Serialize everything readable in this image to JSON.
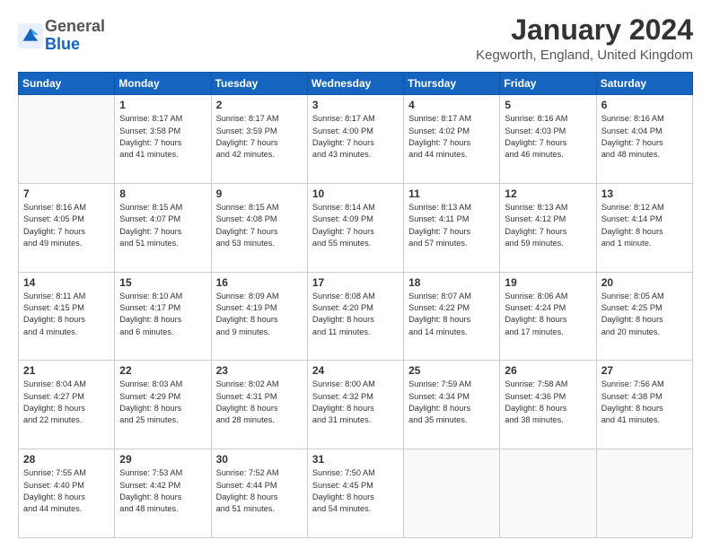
{
  "header": {
    "logo_general": "General",
    "logo_blue": "Blue",
    "month_title": "January 2024",
    "location": "Kegworth, England, United Kingdom"
  },
  "weekdays": [
    "Sunday",
    "Monday",
    "Tuesday",
    "Wednesday",
    "Thursday",
    "Friday",
    "Saturday"
  ],
  "weeks": [
    [
      {
        "day": "",
        "info": ""
      },
      {
        "day": "1",
        "info": "Sunrise: 8:17 AM\nSunset: 3:58 PM\nDaylight: 7 hours\nand 41 minutes."
      },
      {
        "day": "2",
        "info": "Sunrise: 8:17 AM\nSunset: 3:59 PM\nDaylight: 7 hours\nand 42 minutes."
      },
      {
        "day": "3",
        "info": "Sunrise: 8:17 AM\nSunset: 4:00 PM\nDaylight: 7 hours\nand 43 minutes."
      },
      {
        "day": "4",
        "info": "Sunrise: 8:17 AM\nSunset: 4:02 PM\nDaylight: 7 hours\nand 44 minutes."
      },
      {
        "day": "5",
        "info": "Sunrise: 8:16 AM\nSunset: 4:03 PM\nDaylight: 7 hours\nand 46 minutes."
      },
      {
        "day": "6",
        "info": "Sunrise: 8:16 AM\nSunset: 4:04 PM\nDaylight: 7 hours\nand 48 minutes."
      }
    ],
    [
      {
        "day": "7",
        "info": "Sunrise: 8:16 AM\nSunset: 4:05 PM\nDaylight: 7 hours\nand 49 minutes."
      },
      {
        "day": "8",
        "info": "Sunrise: 8:15 AM\nSunset: 4:07 PM\nDaylight: 7 hours\nand 51 minutes."
      },
      {
        "day": "9",
        "info": "Sunrise: 8:15 AM\nSunset: 4:08 PM\nDaylight: 7 hours\nand 53 minutes."
      },
      {
        "day": "10",
        "info": "Sunrise: 8:14 AM\nSunset: 4:09 PM\nDaylight: 7 hours\nand 55 minutes."
      },
      {
        "day": "11",
        "info": "Sunrise: 8:13 AM\nSunset: 4:11 PM\nDaylight: 7 hours\nand 57 minutes."
      },
      {
        "day": "12",
        "info": "Sunrise: 8:13 AM\nSunset: 4:12 PM\nDaylight: 7 hours\nand 59 minutes."
      },
      {
        "day": "13",
        "info": "Sunrise: 8:12 AM\nSunset: 4:14 PM\nDaylight: 8 hours\nand 1 minute."
      }
    ],
    [
      {
        "day": "14",
        "info": "Sunrise: 8:11 AM\nSunset: 4:15 PM\nDaylight: 8 hours\nand 4 minutes."
      },
      {
        "day": "15",
        "info": "Sunrise: 8:10 AM\nSunset: 4:17 PM\nDaylight: 8 hours\nand 6 minutes."
      },
      {
        "day": "16",
        "info": "Sunrise: 8:09 AM\nSunset: 4:19 PM\nDaylight: 8 hours\nand 9 minutes."
      },
      {
        "day": "17",
        "info": "Sunrise: 8:08 AM\nSunset: 4:20 PM\nDaylight: 8 hours\nand 11 minutes."
      },
      {
        "day": "18",
        "info": "Sunrise: 8:07 AM\nSunset: 4:22 PM\nDaylight: 8 hours\nand 14 minutes."
      },
      {
        "day": "19",
        "info": "Sunrise: 8:06 AM\nSunset: 4:24 PM\nDaylight: 8 hours\nand 17 minutes."
      },
      {
        "day": "20",
        "info": "Sunrise: 8:05 AM\nSunset: 4:25 PM\nDaylight: 8 hours\nand 20 minutes."
      }
    ],
    [
      {
        "day": "21",
        "info": "Sunrise: 8:04 AM\nSunset: 4:27 PM\nDaylight: 8 hours\nand 22 minutes."
      },
      {
        "day": "22",
        "info": "Sunrise: 8:03 AM\nSunset: 4:29 PM\nDaylight: 8 hours\nand 25 minutes."
      },
      {
        "day": "23",
        "info": "Sunrise: 8:02 AM\nSunset: 4:31 PM\nDaylight: 8 hours\nand 28 minutes."
      },
      {
        "day": "24",
        "info": "Sunrise: 8:00 AM\nSunset: 4:32 PM\nDaylight: 8 hours\nand 31 minutes."
      },
      {
        "day": "25",
        "info": "Sunrise: 7:59 AM\nSunset: 4:34 PM\nDaylight: 8 hours\nand 35 minutes."
      },
      {
        "day": "26",
        "info": "Sunrise: 7:58 AM\nSunset: 4:36 PM\nDaylight: 8 hours\nand 38 minutes."
      },
      {
        "day": "27",
        "info": "Sunrise: 7:56 AM\nSunset: 4:38 PM\nDaylight: 8 hours\nand 41 minutes."
      }
    ],
    [
      {
        "day": "28",
        "info": "Sunrise: 7:55 AM\nSunset: 4:40 PM\nDaylight: 8 hours\nand 44 minutes."
      },
      {
        "day": "29",
        "info": "Sunrise: 7:53 AM\nSunset: 4:42 PM\nDaylight: 8 hours\nand 48 minutes."
      },
      {
        "day": "30",
        "info": "Sunrise: 7:52 AM\nSunset: 4:44 PM\nDaylight: 8 hours\nand 51 minutes."
      },
      {
        "day": "31",
        "info": "Sunrise: 7:50 AM\nSunset: 4:45 PM\nDaylight: 8 hours\nand 54 minutes."
      },
      {
        "day": "",
        "info": ""
      },
      {
        "day": "",
        "info": ""
      },
      {
        "day": "",
        "info": ""
      }
    ]
  ]
}
